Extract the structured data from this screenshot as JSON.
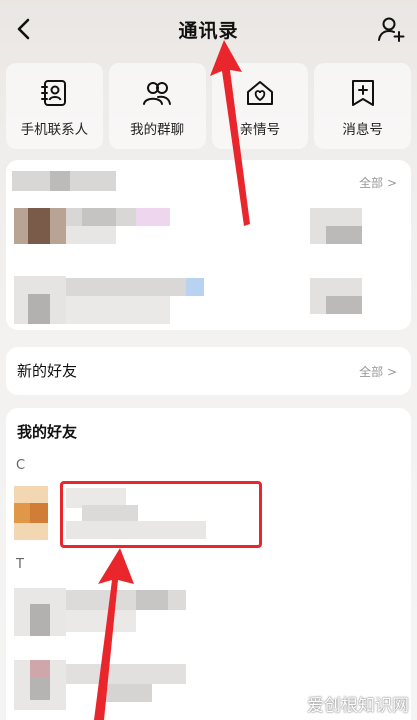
{
  "header": {
    "title": "通讯录"
  },
  "quick_actions": [
    {
      "label": "手机联系人",
      "icon": "contact-book-icon"
    },
    {
      "label": "我的群聊",
      "icon": "group-icon"
    },
    {
      "label": "亲情号",
      "icon": "family-house-icon"
    },
    {
      "label": "消息号",
      "icon": "message-plus-icon"
    }
  ],
  "recent": {
    "more_label": "全部 >"
  },
  "new_friends": {
    "title": "新的好友",
    "more_label": "全部 >"
  },
  "my_friends": {
    "title": "我的好友",
    "groups": [
      {
        "letter": "C"
      },
      {
        "letter": "T"
      }
    ]
  },
  "watermark": "爱创根知识网",
  "colors": {
    "annotation_red": "#e8262c",
    "background": "#f0eeec"
  }
}
